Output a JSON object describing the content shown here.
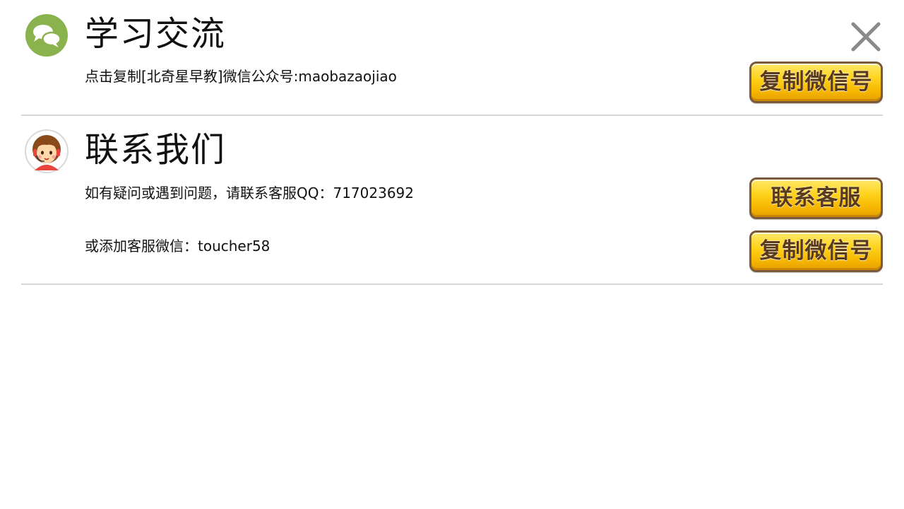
{
  "icons": {
    "close": "close-icon",
    "wechat": "wechat-chat-bubbles-icon",
    "support": "customer-service-avatar-icon"
  },
  "colors": {
    "wechat_green": "#8ab24d",
    "button_gold": "#ffd21c",
    "button_border": "#7a5a3a",
    "button_text": "#5a3a1c",
    "divider": "#d6d6d6"
  },
  "study": {
    "title": "学习交流",
    "description": "点击复制[北奇星早教]微信公众号:maobazaojiao",
    "copy_button_label": "复制微信号"
  },
  "contact": {
    "title": "联系我们",
    "qq_text": "如有疑问或遇到问题，请联系客服QQ：717023692",
    "contact_button_label": "联系客服",
    "wechat_text": "或添加客服微信：toucher58",
    "copy_button_label": "复制微信号"
  }
}
